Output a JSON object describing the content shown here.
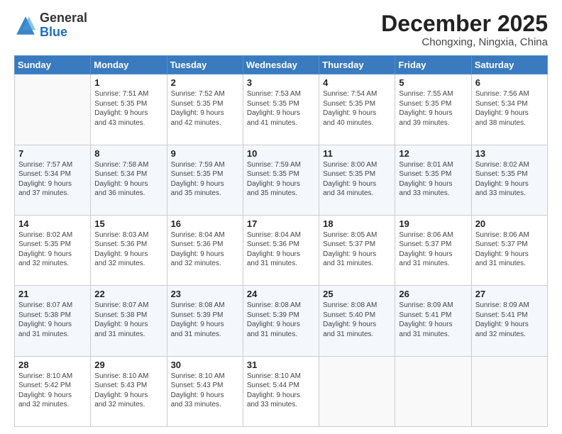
{
  "header": {
    "logo_general": "General",
    "logo_blue": "Blue",
    "month_title": "December 2025",
    "subtitle": "Chongxing, Ningxia, China"
  },
  "days_of_week": [
    "Sunday",
    "Monday",
    "Tuesday",
    "Wednesday",
    "Thursday",
    "Friday",
    "Saturday"
  ],
  "weeks": [
    [
      {
        "day": "",
        "info": ""
      },
      {
        "day": "1",
        "info": "Sunrise: 7:51 AM\nSunset: 5:35 PM\nDaylight: 9 hours\nand 43 minutes."
      },
      {
        "day": "2",
        "info": "Sunrise: 7:52 AM\nSunset: 5:35 PM\nDaylight: 9 hours\nand 42 minutes."
      },
      {
        "day": "3",
        "info": "Sunrise: 7:53 AM\nSunset: 5:35 PM\nDaylight: 9 hours\nand 41 minutes."
      },
      {
        "day": "4",
        "info": "Sunrise: 7:54 AM\nSunset: 5:35 PM\nDaylight: 9 hours\nand 40 minutes."
      },
      {
        "day": "5",
        "info": "Sunrise: 7:55 AM\nSunset: 5:35 PM\nDaylight: 9 hours\nand 39 minutes."
      },
      {
        "day": "6",
        "info": "Sunrise: 7:56 AM\nSunset: 5:34 PM\nDaylight: 9 hours\nand 38 minutes."
      }
    ],
    [
      {
        "day": "7",
        "info": "Sunrise: 7:57 AM\nSunset: 5:34 PM\nDaylight: 9 hours\nand 37 minutes."
      },
      {
        "day": "8",
        "info": "Sunrise: 7:58 AM\nSunset: 5:34 PM\nDaylight: 9 hours\nand 36 minutes."
      },
      {
        "day": "9",
        "info": "Sunrise: 7:59 AM\nSunset: 5:35 PM\nDaylight: 9 hours\nand 35 minutes."
      },
      {
        "day": "10",
        "info": "Sunrise: 7:59 AM\nSunset: 5:35 PM\nDaylight: 9 hours\nand 35 minutes."
      },
      {
        "day": "11",
        "info": "Sunrise: 8:00 AM\nSunset: 5:35 PM\nDaylight: 9 hours\nand 34 minutes."
      },
      {
        "day": "12",
        "info": "Sunrise: 8:01 AM\nSunset: 5:35 PM\nDaylight: 9 hours\nand 33 minutes."
      },
      {
        "day": "13",
        "info": "Sunrise: 8:02 AM\nSunset: 5:35 PM\nDaylight: 9 hours\nand 33 minutes."
      }
    ],
    [
      {
        "day": "14",
        "info": "Sunrise: 8:02 AM\nSunset: 5:35 PM\nDaylight: 9 hours\nand 32 minutes."
      },
      {
        "day": "15",
        "info": "Sunrise: 8:03 AM\nSunset: 5:36 PM\nDaylight: 9 hours\nand 32 minutes."
      },
      {
        "day": "16",
        "info": "Sunrise: 8:04 AM\nSunset: 5:36 PM\nDaylight: 9 hours\nand 32 minutes."
      },
      {
        "day": "17",
        "info": "Sunrise: 8:04 AM\nSunset: 5:36 PM\nDaylight: 9 hours\nand 31 minutes."
      },
      {
        "day": "18",
        "info": "Sunrise: 8:05 AM\nSunset: 5:37 PM\nDaylight: 9 hours\nand 31 minutes."
      },
      {
        "day": "19",
        "info": "Sunrise: 8:06 AM\nSunset: 5:37 PM\nDaylight: 9 hours\nand 31 minutes."
      },
      {
        "day": "20",
        "info": "Sunrise: 8:06 AM\nSunset: 5:37 PM\nDaylight: 9 hours\nand 31 minutes."
      }
    ],
    [
      {
        "day": "21",
        "info": "Sunrise: 8:07 AM\nSunset: 5:38 PM\nDaylight: 9 hours\nand 31 minutes."
      },
      {
        "day": "22",
        "info": "Sunrise: 8:07 AM\nSunset: 5:38 PM\nDaylight: 9 hours\nand 31 minutes."
      },
      {
        "day": "23",
        "info": "Sunrise: 8:08 AM\nSunset: 5:39 PM\nDaylight: 9 hours\nand 31 minutes."
      },
      {
        "day": "24",
        "info": "Sunrise: 8:08 AM\nSunset: 5:39 PM\nDaylight: 9 hours\nand 31 minutes."
      },
      {
        "day": "25",
        "info": "Sunrise: 8:08 AM\nSunset: 5:40 PM\nDaylight: 9 hours\nand 31 minutes."
      },
      {
        "day": "26",
        "info": "Sunrise: 8:09 AM\nSunset: 5:41 PM\nDaylight: 9 hours\nand 31 minutes."
      },
      {
        "day": "27",
        "info": "Sunrise: 8:09 AM\nSunset: 5:41 PM\nDaylight: 9 hours\nand 32 minutes."
      }
    ],
    [
      {
        "day": "28",
        "info": "Sunrise: 8:10 AM\nSunset: 5:42 PM\nDaylight: 9 hours\nand 32 minutes."
      },
      {
        "day": "29",
        "info": "Sunrise: 8:10 AM\nSunset: 5:43 PM\nDaylight: 9 hours\nand 32 minutes."
      },
      {
        "day": "30",
        "info": "Sunrise: 8:10 AM\nSunset: 5:43 PM\nDaylight: 9 hours\nand 33 minutes."
      },
      {
        "day": "31",
        "info": "Sunrise: 8:10 AM\nSunset: 5:44 PM\nDaylight: 9 hours\nand 33 minutes."
      },
      {
        "day": "",
        "info": ""
      },
      {
        "day": "",
        "info": ""
      },
      {
        "day": "",
        "info": ""
      }
    ]
  ]
}
